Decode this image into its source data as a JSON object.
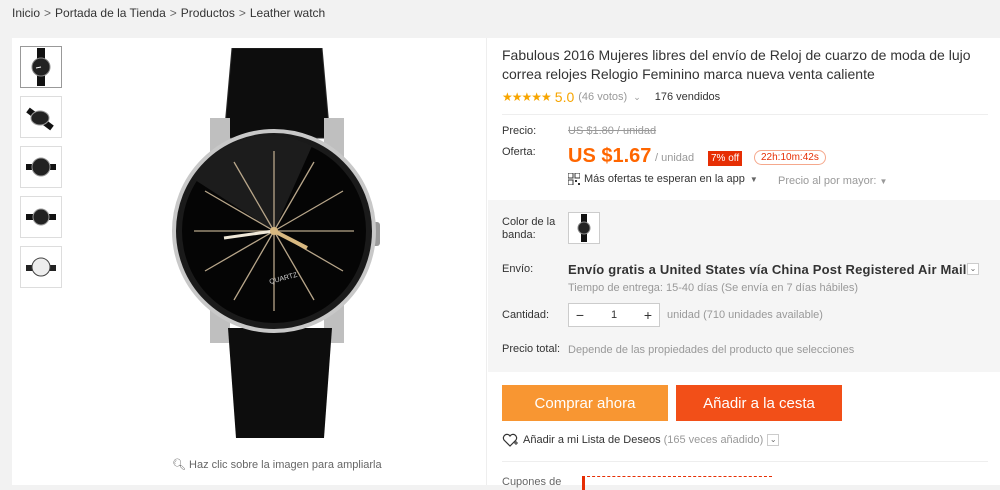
{
  "breadcrumb": {
    "items": [
      "Inicio",
      "Portada de la Tienda",
      "Productos",
      "Leather watch"
    ],
    "separator": ">"
  },
  "gallery": {
    "thumbnails": [
      "watch-front",
      "watch-side",
      "watch-angle",
      "watch-front-small",
      "watch-back"
    ],
    "zoom_hint": "Haz clic sobre la imagen para ampliarla",
    "dial_text": "QUARTZ"
  },
  "product": {
    "title": "Fabulous 2016 Mujeres libres del envío de Reloj de cuarzo de moda de lujo correa relojes Relogio Feminino marca nueva venta caliente",
    "stars": "★★★★★",
    "score": "5.0",
    "votes": "(46 votos)",
    "sold": "176 vendidos"
  },
  "pricing": {
    "price_label": "Precio:",
    "old_price": "US $1.80 / unidad",
    "offer_label": "Oferta:",
    "price": "US $1.67",
    "unit": "/ unidad",
    "discount": "7% off",
    "timer": "22h:10m:42s",
    "app_offer": "Más ofertas te esperan en la app",
    "wholesale": "Precio al por mayor:"
  },
  "options": {
    "color_label": "Color de la banda:",
    "shipping_label": "Envío:",
    "shipping_text": "Envío gratis a United States vía China Post Registered Air Mail",
    "delivery_time": "Tiempo de entrega: 15-40 días (Se envía en 7 días hábiles)",
    "qty_label": "Cantidad:",
    "qty_value": "1",
    "available": "unidad (710 unidades available)",
    "total_label": "Precio total:",
    "total_note": "Depende de las propiedades del producto que selecciones"
  },
  "actions": {
    "buy_now": "Comprar ahora",
    "add_cart": "Añadir a la cesta",
    "wishlist": "Añadir a mi Lista de Deseos",
    "wishlist_count": "(165 veces añadido)"
  },
  "coupons": {
    "label": "Cupones de"
  },
  "colors": {
    "price_orange": "#ff6600",
    "buy_button": "#f89632",
    "cart_button": "#f24f18",
    "star": "#f7a500"
  }
}
